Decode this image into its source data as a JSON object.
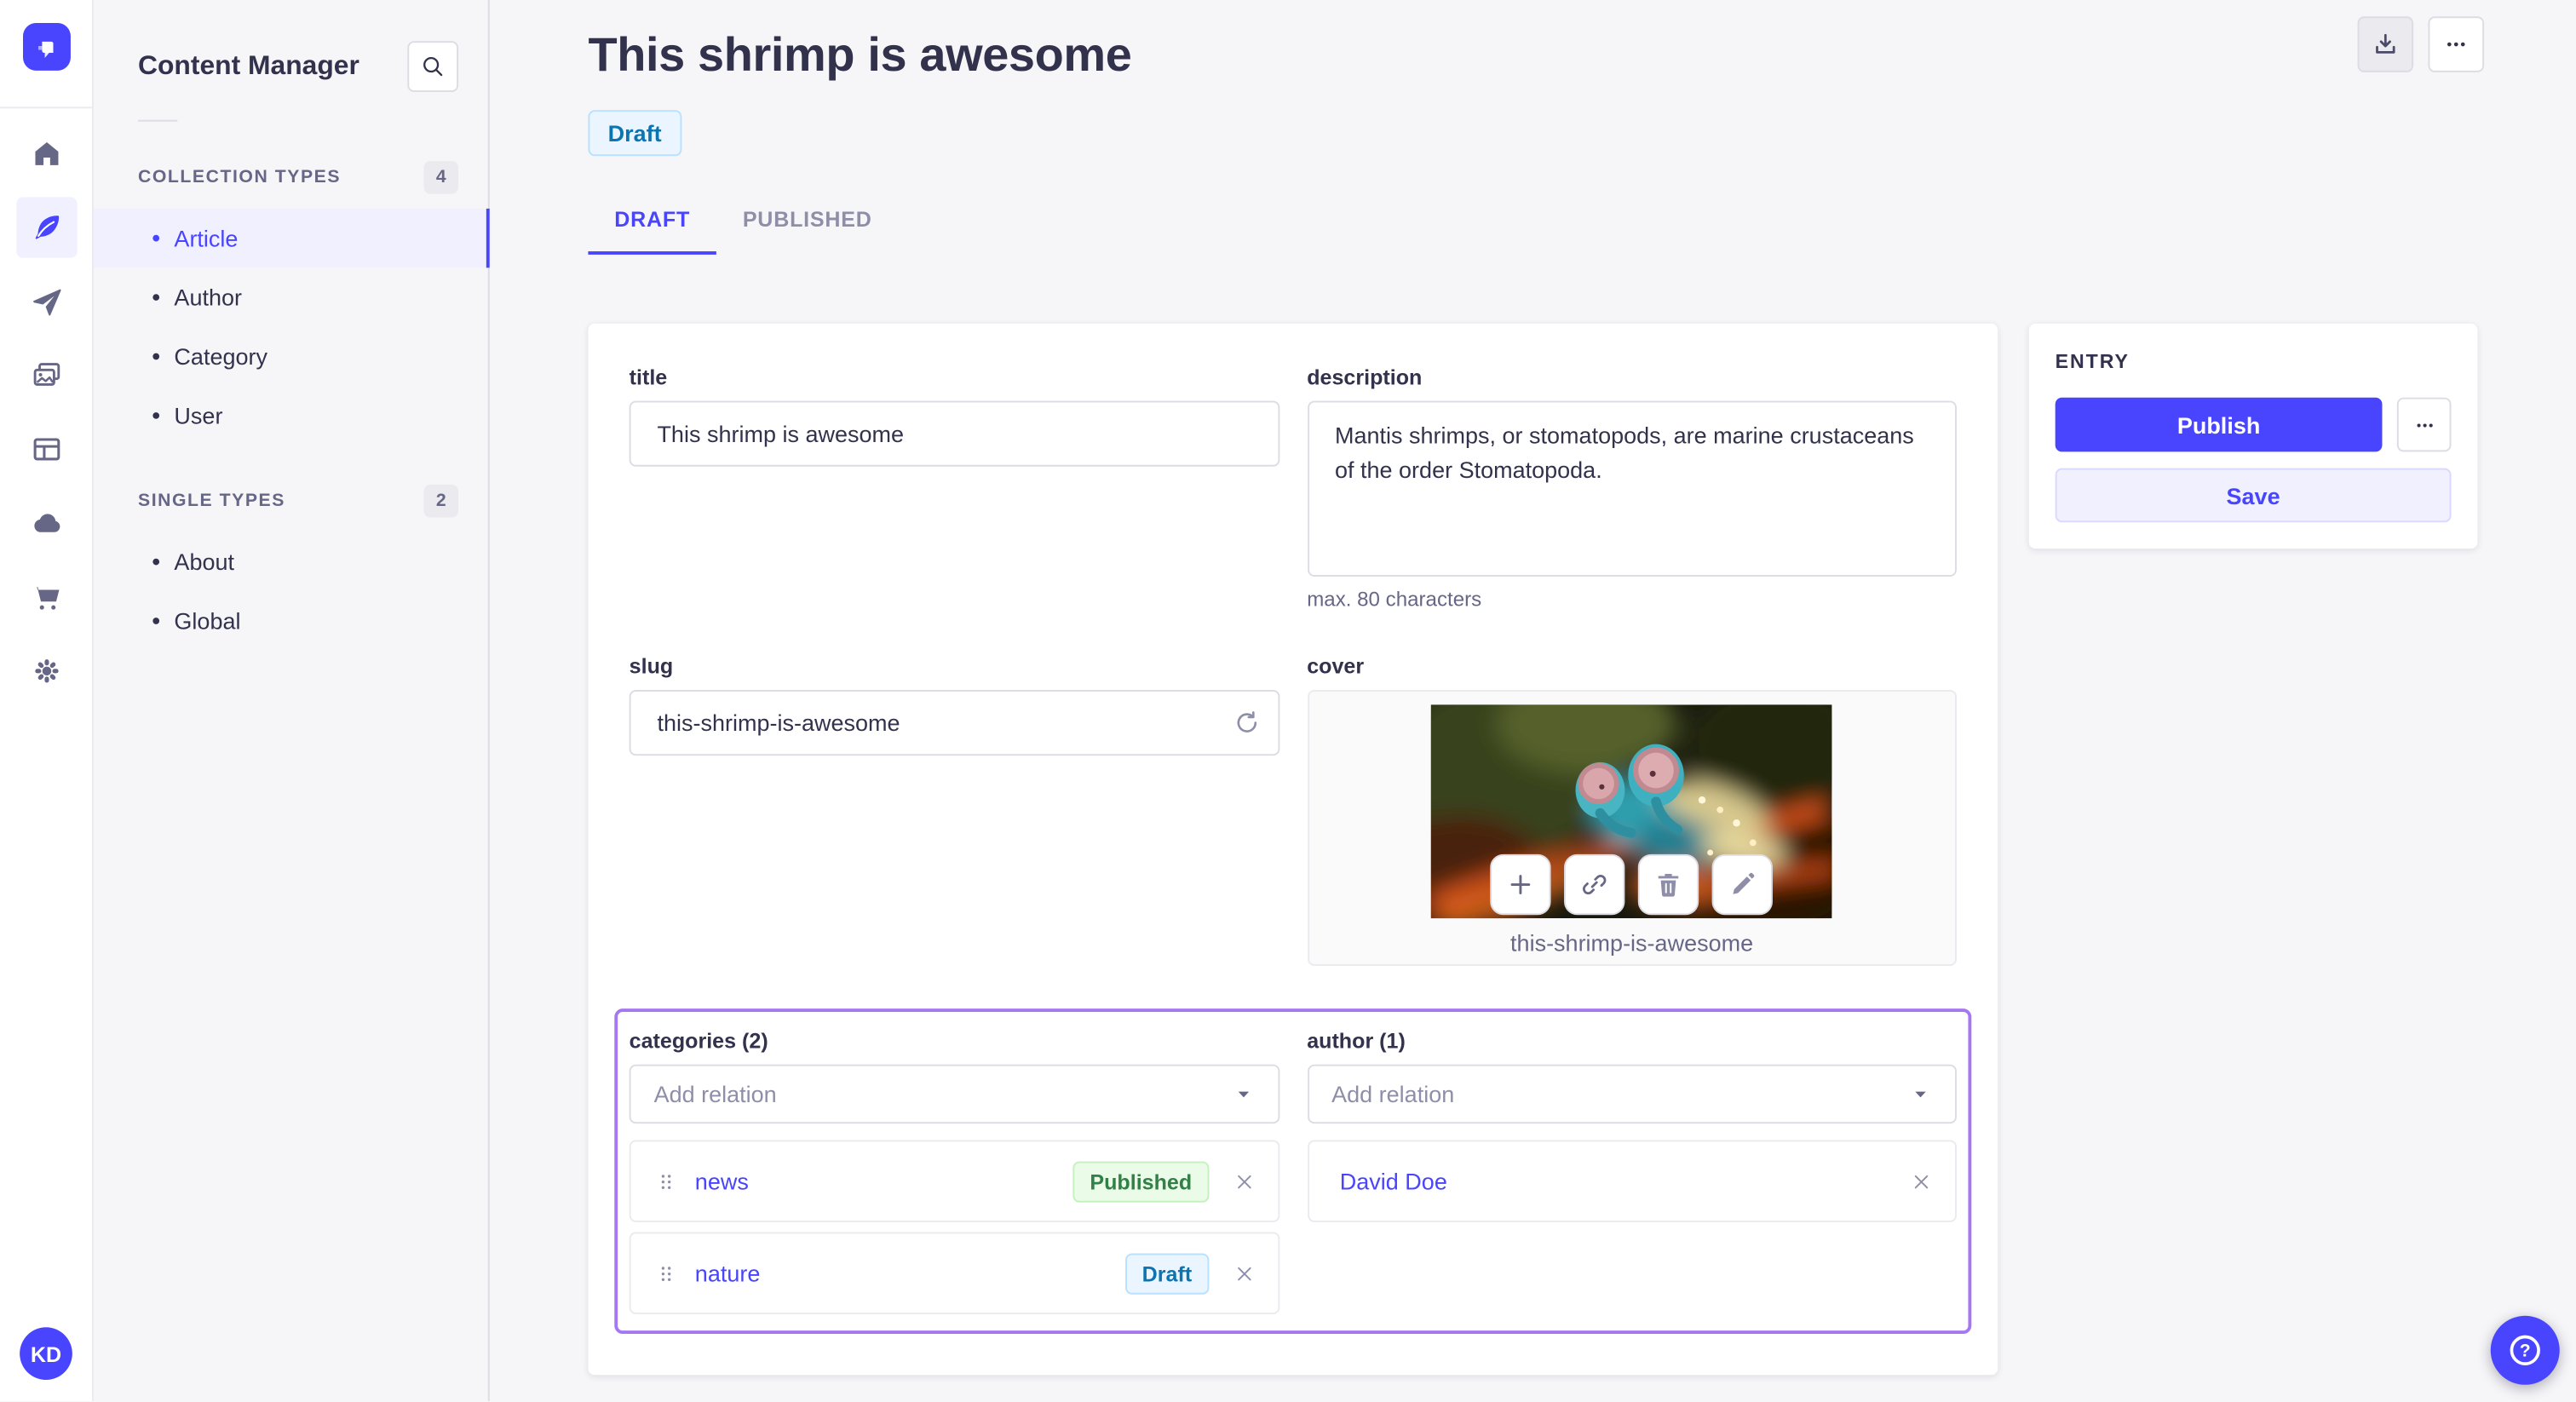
{
  "colors": {
    "accent": "#4945ff",
    "accent_light_bg": "#f0f0ff",
    "accent_light_border": "#d9d8ff",
    "relations_outline": "#a578f2",
    "draft_text": "#0c75af",
    "draft_bg": "#eaf5ff",
    "draft_border": "#b8e1ff",
    "published_text": "#328048",
    "published_bg": "#eafbe7",
    "published_border": "#c6f0c2",
    "text_primary": "#32324d",
    "text_muted": "#666687"
  },
  "nav_rail": {
    "logo": "strapi-logo",
    "avatar_initials": "KD"
  },
  "sidebar": {
    "title": "Content Manager",
    "sections": [
      {
        "label": "COLLECTION TYPES",
        "count": "4",
        "items": [
          {
            "label": "Article",
            "active": true
          },
          {
            "label": "Author"
          },
          {
            "label": "Category"
          },
          {
            "label": "User"
          }
        ]
      },
      {
        "label": "SINGLE TYPES",
        "count": "2",
        "items": [
          {
            "label": "About"
          },
          {
            "label": "Global"
          }
        ]
      }
    ]
  },
  "header": {
    "title": "This shrimp is awesome",
    "status": "Draft",
    "tabs": [
      {
        "label": "DRAFT",
        "active": true
      },
      {
        "label": "PUBLISHED"
      }
    ]
  },
  "form": {
    "title": {
      "label": "title",
      "value": "This shrimp is awesome"
    },
    "description": {
      "label": "description",
      "value": "Mantis shrimps, or stomatopods, are marine crustaceans of the order Stomatopoda.",
      "hint": "max. 80 characters"
    },
    "slug": {
      "label": "slug",
      "value": "this-shrimp-is-awesome"
    },
    "cover": {
      "label": "cover",
      "caption": "this-shrimp-is-awesome"
    },
    "categories": {
      "label": "categories (2)",
      "placeholder": "Add relation",
      "items": [
        {
          "name": "news",
          "status": "Published"
        },
        {
          "name": "nature",
          "status": "Draft"
        }
      ]
    },
    "author": {
      "label": "author (1)",
      "placeholder": "Add relation",
      "items": [
        {
          "name": "David Doe"
        }
      ]
    }
  },
  "entry_panel": {
    "title": "ENTRY",
    "publish": "Publish",
    "save": "Save"
  }
}
